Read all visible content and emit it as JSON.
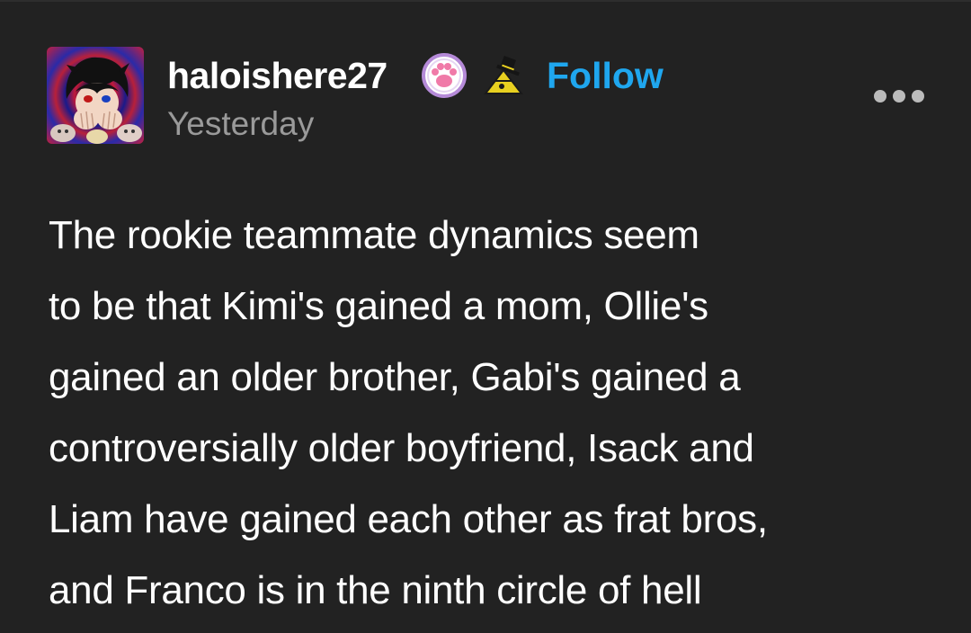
{
  "post": {
    "author": "haloishere27",
    "follow_label": "Follow",
    "timestamp": "Yesterday",
    "badges": [
      "paw-badge-icon",
      "top-hat-badge-icon"
    ],
    "body_lines": [
      "The rookie teammate dynamics seem",
      "to be that Kimi's gained a mom, Ollie's",
      "gained an older brother, Gabi's gained a",
      "controversially older boyfriend, Isack and",
      "Liam have gained each other as frat bros,",
      "and Franco is in the ninth circle of hell"
    ]
  },
  "colors": {
    "background": "#222222",
    "follow": "#1fa7ef",
    "timestamp": "#9a9a9a",
    "text": "#ffffff"
  }
}
